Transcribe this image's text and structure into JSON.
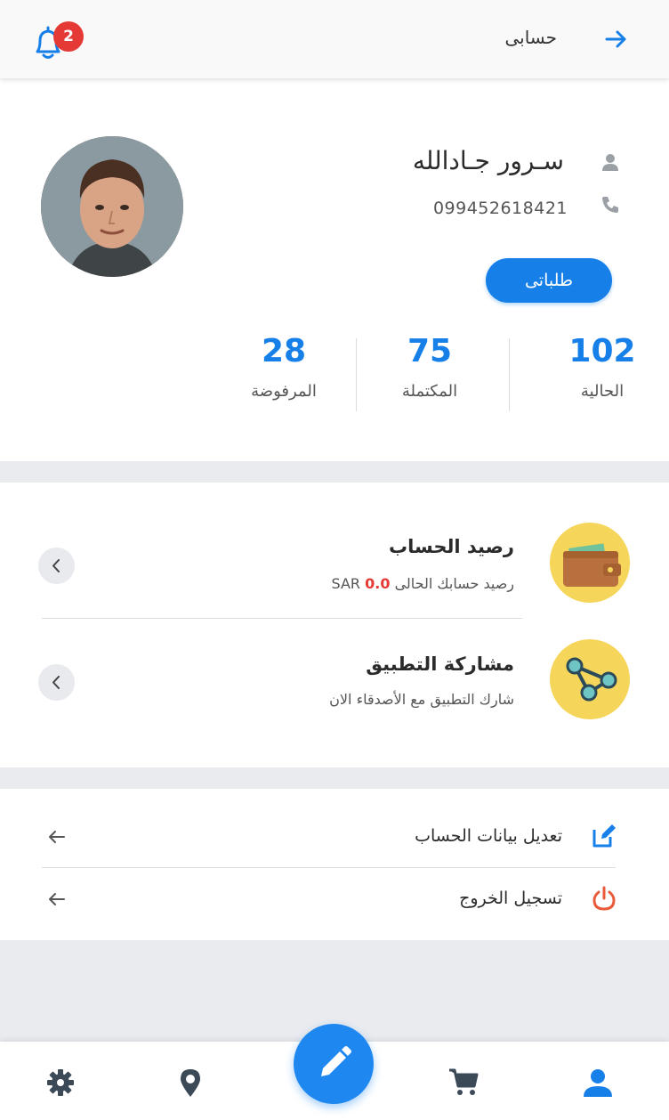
{
  "header": {
    "title": "حسابى",
    "notification_count": "2"
  },
  "profile": {
    "name": "سـرور جـادالله",
    "phone": "099452618421",
    "orders_button": "طلباتى",
    "stats": [
      {
        "value": "102",
        "label": "الحالية"
      },
      {
        "value": "75",
        "label": "المكتملة"
      },
      {
        "value": "28",
        "label": "المرفوضة"
      }
    ]
  },
  "balance": {
    "title": "رصيد الحساب",
    "subtitle_prefix": "رصيد حسابك الحالى",
    "amount": "0.0",
    "currency": "SAR"
  },
  "share": {
    "title": "مشاركة التطبيق",
    "subtitle": "شارك التطبيق مع الأصدقاء الان"
  },
  "actions": {
    "edit_label": "تعديل بيانات الحساب",
    "logout_label": "تسجيل الخروج"
  },
  "colors": {
    "primary": "#1780e8",
    "danger": "#e53935",
    "icon_circle": "#f5d55a"
  },
  "icons": {
    "bottom_nav": [
      "gear-icon",
      "map-pin-icon",
      "pencil-icon",
      "cart-icon",
      "user-icon"
    ]
  }
}
